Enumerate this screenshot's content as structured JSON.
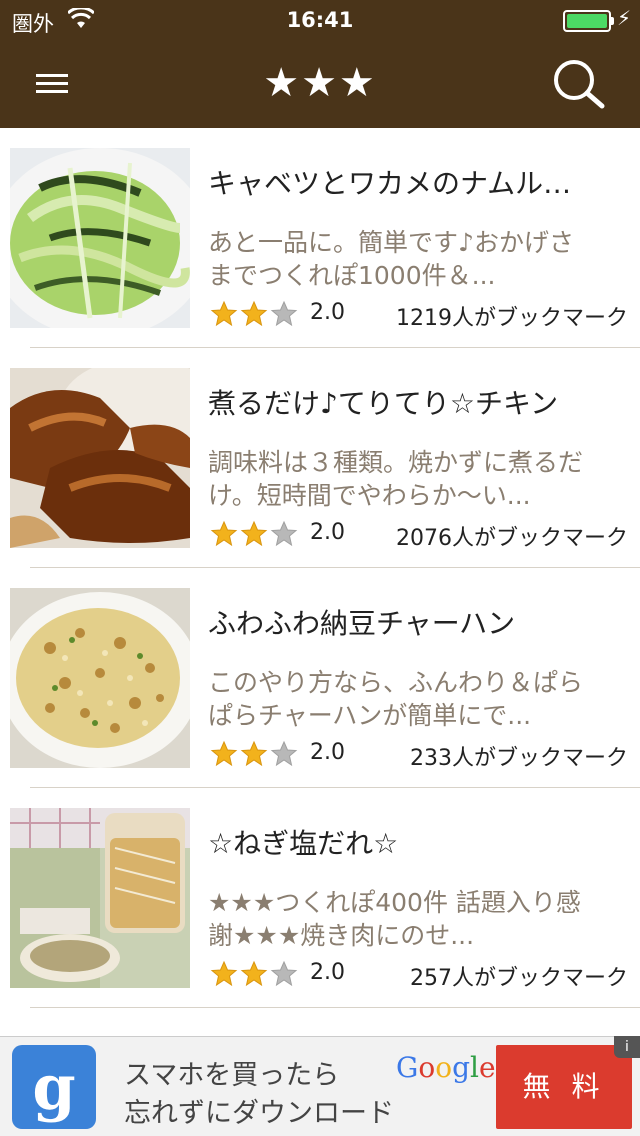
{
  "status_bar": {
    "carrier": "圏外",
    "time": "16:41",
    "battery_level": 1.0
  },
  "header": {
    "title": "★★★",
    "menu_icon": "hamburger-menu-icon",
    "search_icon": "search-icon"
  },
  "recipes": [
    {
      "title": "キャベツとワカメのナムル…",
      "description": "あと一品に。簡単です♪おかげさ\nまでつくれぽ1000件＆...",
      "stars_filled": 2,
      "stars_total": 3,
      "rating": "2.0",
      "bookmark": "1219人がブックマーク",
      "thumb_icon": "cabbage-wakame-namul-photo"
    },
    {
      "title": "煮るだけ♪てりてり☆チキン",
      "description": "調味料は３種類。焼かずに煮るだ\nけ。短時間でやわらか～い...",
      "stars_filled": 2,
      "stars_total": 3,
      "rating": "2.0",
      "bookmark": "2076人がブックマーク",
      "thumb_icon": "teriyaki-chicken-photo"
    },
    {
      "title": "ふわふわ納豆チャーハン",
      "description": "このやり方なら、ふんわり＆ぱら\nぱらチャーハンが簡単にで...",
      "stars_filled": 2,
      "stars_total": 3,
      "rating": "2.0",
      "bookmark": "233人がブックマーク",
      "thumb_icon": "natto-fried-rice-photo"
    },
    {
      "title": "☆ねぎ塩だれ☆",
      "description": "★★★つくれぽ400件 話題入り感\n謝★★★焼き肉にのせ...",
      "stars_filled": 2,
      "stars_total": 3,
      "rating": "2.0",
      "bookmark": "257人がブックマーク",
      "thumb_icon": "negi-shio-sauce-photo"
    }
  ],
  "ad": {
    "line1": "スマホを買ったら",
    "line2": "忘れずにダウンロード",
    "brand": "Google",
    "cta": "無 料",
    "logo_letter": "g",
    "info_icon": "info-icon"
  },
  "colors": {
    "header_bg": "#4a3419",
    "star_gold": "#f2b21c",
    "star_gray": "#b8b8b8",
    "desc_text": "#8a7e70",
    "ad_button": "#db3b2e"
  }
}
